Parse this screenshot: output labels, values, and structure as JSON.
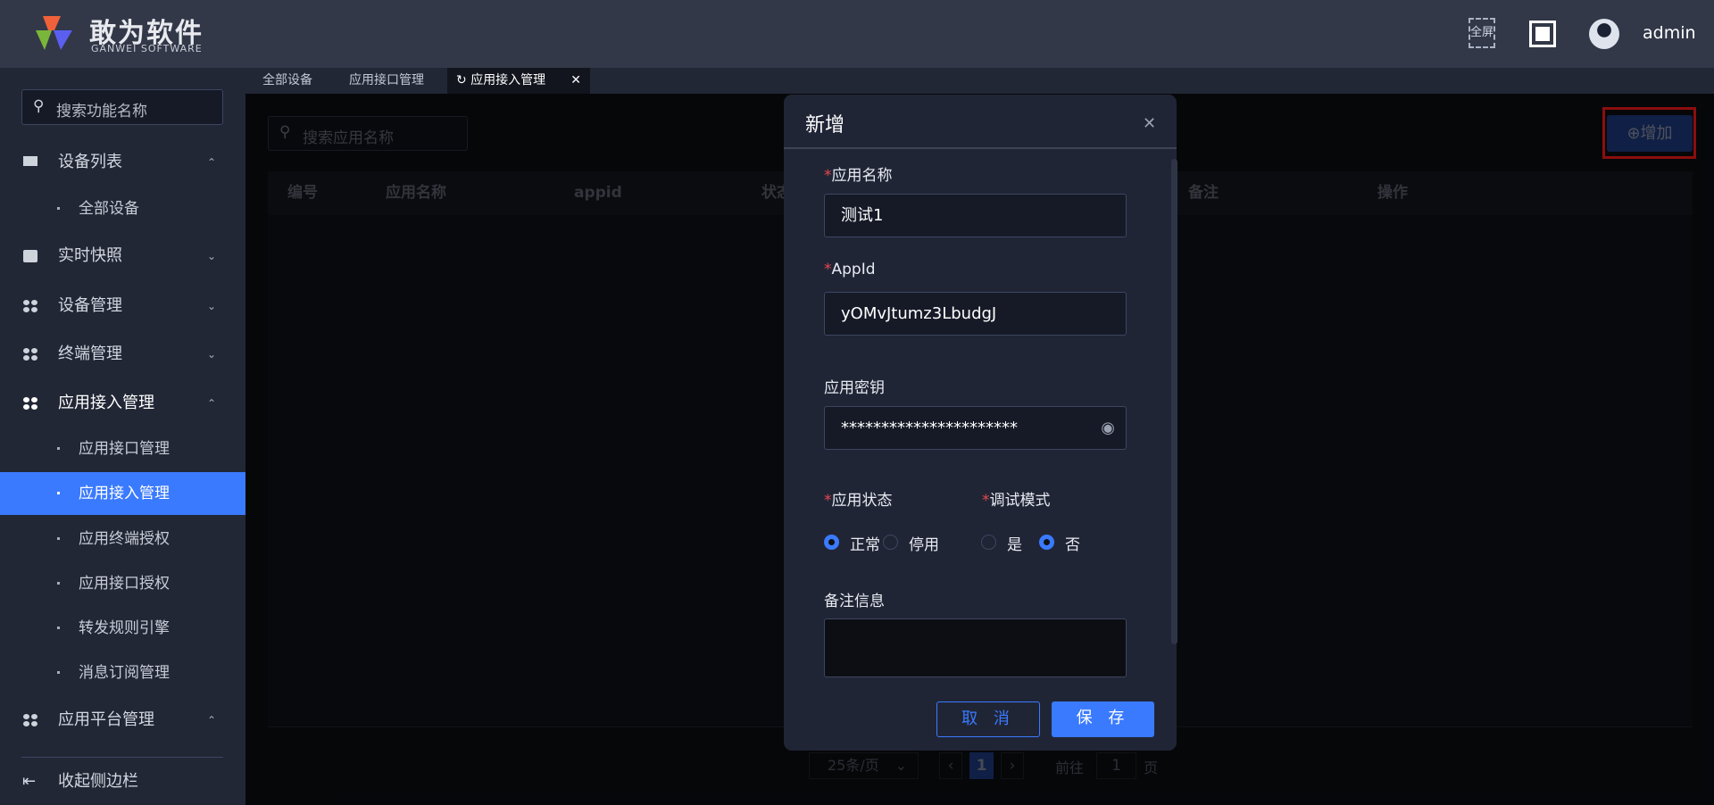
{
  "header": {
    "logo_cn": "敢为软件",
    "logo_en": "GANWEI SOFTWARE",
    "fullscreen_label": "全屏",
    "user": "admin"
  },
  "sidebar": {
    "search_placeholder": "搜索功能名称",
    "menus": [
      {
        "label": "设备列表",
        "icon": "monitor-icon"
      },
      {
        "label": "实时快照",
        "icon": "camera-icon"
      },
      {
        "label": "设备管理",
        "icon": "clover-icon"
      },
      {
        "label": "终端管理",
        "icon": "clover-icon"
      },
      {
        "label": "应用接入管理",
        "icon": "clover-icon"
      },
      {
        "label": "应用平台管理",
        "icon": "clover-icon"
      }
    ],
    "subs": [
      "全部设备",
      "应用接口管理",
      "应用接入管理",
      "应用终端授权",
      "应用接口授权",
      "转发规则引擎",
      "消息订阅管理"
    ],
    "collapse": "收起侧边栏"
  },
  "tabs": [
    "全部设备",
    "应用接口管理",
    "应用接入管理"
  ],
  "main": {
    "search_placeholder": "搜索应用名称",
    "add_label": "增加",
    "columns": [
      "编号",
      "应用名称",
      "appid",
      "状态",
      "备注",
      "操作"
    ],
    "pagination": {
      "page_size": "25条/页",
      "current": "1",
      "goto_label": "前往",
      "goto_value": "1",
      "page_suffix": "页"
    }
  },
  "dialog": {
    "title": "新增",
    "name_label": "应用名称",
    "name_value": "测试1",
    "appid_label": "AppId",
    "appid_value": "yOMvJtumz3LbudgJ",
    "secret_label": "应用密钥",
    "secret_value": "**********************",
    "status_label": "应用状态",
    "status_options": [
      "正常",
      "停用"
    ],
    "debug_label": "调试模式",
    "debug_options": [
      "是",
      "否"
    ],
    "remark_label": "备注信息",
    "cancel": "取 消",
    "save": "保 存"
  },
  "colors": {
    "accent": "#3a7afe",
    "header": "#323848",
    "sidebar": "#222736",
    "highlight": "#ff1a1a"
  }
}
